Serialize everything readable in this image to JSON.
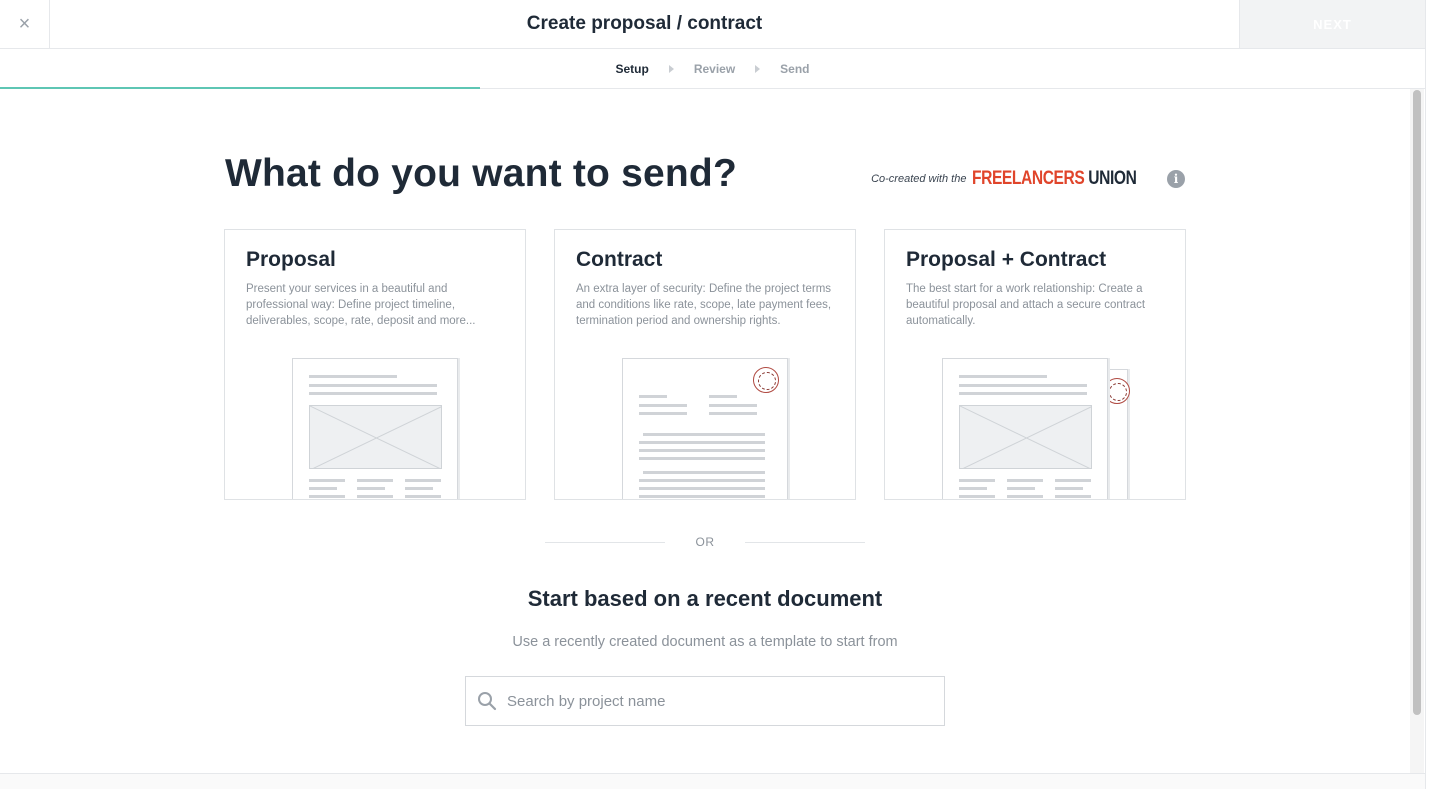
{
  "header": {
    "close_glyph": "×",
    "title": "Create proposal / contract",
    "next_label": "NEXT"
  },
  "steps": [
    {
      "label": "Setup",
      "active": true
    },
    {
      "label": "Review",
      "active": false
    },
    {
      "label": "Send",
      "active": false
    }
  ],
  "main": {
    "title": "What do you want to send?",
    "cocreated_text": "Co-created with the",
    "logo_part1": "FREELANCERS",
    "logo_part2": "UNION",
    "info_glyph": "i"
  },
  "cards": [
    {
      "title": "Proposal",
      "description": "Present your services in a beautiful and professional way: Define project timeline, deliverables, scope, rate, deposit and more..."
    },
    {
      "title": "Contract",
      "description": "An extra layer of security: Define the project terms and conditions like rate, scope, late payment fees, termination period and ownership rights."
    },
    {
      "title": "Proposal + Contract",
      "description": "The best start for a work relationship: Create a beautiful proposal and attach a secure contract automatically."
    }
  ],
  "divider": {
    "label": "OR"
  },
  "recent": {
    "title": "Start based on a recent document",
    "subtitle": "Use a recently created document as a template to start from",
    "search_placeholder": "Search by project name"
  },
  "colors": {
    "accent": "#5ec6b4",
    "brand_red": "#e0452b"
  }
}
